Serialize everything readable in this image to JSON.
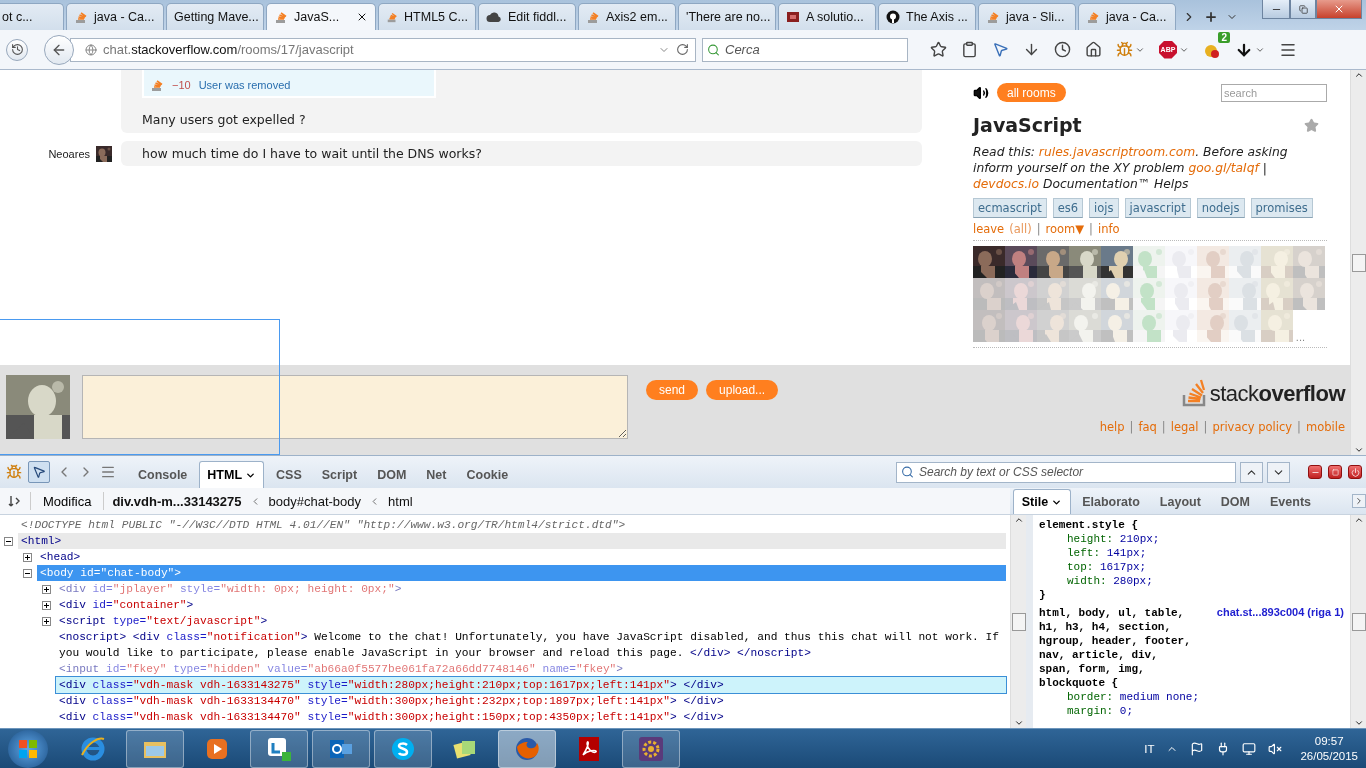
{
  "browser": {
    "tabs": [
      {
        "label": "ot c...",
        "selected": false,
        "kind": "plain"
      },
      {
        "label": "java - Ca...",
        "selected": false,
        "kind": "so"
      },
      {
        "label": "Getting Mave...",
        "selected": false,
        "kind": "plain"
      },
      {
        "label": "JavaS...",
        "selected": true,
        "kind": "so"
      },
      {
        "label": "HTML5 C...",
        "selected": false,
        "kind": "so"
      },
      {
        "label": "Edit fiddl...",
        "selected": false,
        "kind": "cloud"
      },
      {
        "label": "Axis2 em...",
        "selected": false,
        "kind": "so"
      },
      {
        "label": "'There are no...",
        "selected": false,
        "kind": "plain"
      },
      {
        "label": "A solutio...",
        "selected": false,
        "kind": "red"
      },
      {
        "label": "The Axis ...",
        "selected": false,
        "kind": "github"
      },
      {
        "label": "java - Sli...",
        "selected": false,
        "kind": "so"
      },
      {
        "label": "java - Ca...",
        "selected": false,
        "kind": "so"
      }
    ],
    "url_prefix": "chat.",
    "url_domain": "stackoverflow.com",
    "url_path": "/rooms/17/javascript",
    "search_placeholder": "Cerca",
    "adblock_label": "ABP",
    "notification_count": "2"
  },
  "chat": {
    "notice": {
      "score": "−10",
      "text": "User was removed"
    },
    "messages": [
      {
        "text": "Many users got expelled ?"
      },
      {
        "user": "Neoares",
        "text": "how much time do I have to wait until the DNS works?"
      }
    ],
    "send_label": "send",
    "upload_label": "upload..."
  },
  "sidebar": {
    "all_rooms": "all rooms",
    "search_placeholder": "search",
    "title": "JavaScript",
    "starred": false,
    "description": [
      {
        "text": "Read this: ",
        "link": false
      },
      {
        "text": "rules.javascriptroom.com",
        "link": true
      },
      {
        "text": ". Before asking inform yourself on the XY problem ",
        "link": false
      },
      {
        "text": "goo.gl/taIqf",
        "link": true
      },
      {
        "text": " | ",
        "link": false
      },
      {
        "text": "devdocs.io",
        "link": true
      },
      {
        "text": " Documentation™ Helps",
        "link": false
      }
    ],
    "tags": [
      "ecmascript",
      "es6",
      "iojs",
      "javascript",
      "nodejs",
      "promises"
    ],
    "room_links": [
      {
        "text": "leave",
        "kind": "link"
      },
      {
        "text": "(all)",
        "kind": "muted"
      },
      {
        "text": "|",
        "kind": "sep"
      },
      {
        "text": "room▼",
        "kind": "link"
      },
      {
        "text": "|",
        "kind": "sep"
      },
      {
        "text": "info",
        "kind": "link"
      }
    ],
    "members": [
      {
        "kind": "picture",
        "faded": false
      },
      {
        "kind": "picture",
        "faded": false
      },
      {
        "kind": "picture",
        "faded": false
      },
      {
        "kind": "picture",
        "faded": false
      },
      {
        "kind": "picture",
        "faded": false
      },
      {
        "kind": "picture",
        "faded": true
      },
      {
        "kind": "picture",
        "faded": true
      },
      {
        "kind": "picture",
        "faded": true
      },
      {
        "kind": "picture",
        "faded": true
      },
      {
        "kind": "picture",
        "faded": true
      },
      {
        "kind": "picture",
        "faded": true
      },
      {
        "kind": "picture",
        "faded": true
      },
      {
        "kind": "picture",
        "faded": true
      },
      {
        "kind": "picture",
        "faded": true
      },
      {
        "kind": "picture",
        "faded": true
      },
      {
        "kind": "picture",
        "faded": true
      },
      {
        "kind": "picture",
        "faded": true
      },
      {
        "kind": "picture",
        "faded": true
      },
      {
        "kind": "picture",
        "faded": true
      },
      {
        "kind": "picture",
        "faded": true
      },
      {
        "kind": "picture",
        "faded": true
      },
      {
        "kind": "picture",
        "faded": true
      },
      {
        "kind": "picture",
        "faded": true
      },
      {
        "kind": "picture",
        "faded": true
      },
      {
        "kind": "picture",
        "faded": true
      },
      {
        "kind": "picture",
        "faded": true
      },
      {
        "kind": "picture",
        "faded": true
      },
      {
        "kind": "picture",
        "faded": true
      },
      {
        "kind": "picture",
        "faded": true
      },
      {
        "kind": "picture",
        "faded": true
      },
      {
        "kind": "picture",
        "faded": true
      },
      {
        "kind": "picture",
        "faded": true
      }
    ],
    "more_members": "...",
    "logo": {
      "light": "stack",
      "bold": "overflow"
    },
    "footer_links": [
      {
        "text": "help",
        "kind": "link"
      },
      {
        "text": "|",
        "kind": "sep"
      },
      {
        "text": "faq",
        "kind": "link"
      },
      {
        "text": "|",
        "kind": "sep"
      },
      {
        "text": "legal",
        "kind": "link"
      },
      {
        "text": "|",
        "kind": "sep"
      },
      {
        "text": "privacy policy",
        "kind": "link"
      },
      {
        "text": "|",
        "kind": "sep"
      },
      {
        "text": "mobile",
        "kind": "link"
      }
    ]
  },
  "devtools": {
    "tabs": [
      {
        "label": "Console",
        "selected": false,
        "menu": false
      },
      {
        "label": "HTML",
        "selected": true,
        "menu": true
      },
      {
        "label": "CSS",
        "selected": false,
        "menu": false
      },
      {
        "label": "Script",
        "selected": false,
        "menu": false
      },
      {
        "label": "DOM",
        "selected": false,
        "menu": false
      },
      {
        "label": "Net",
        "selected": false,
        "menu": false
      },
      {
        "label": "Cookie",
        "selected": false,
        "menu": false
      }
    ],
    "search_placeholder": "Search by text or CSS selector",
    "edit_label": "Modifica",
    "breadcrumbs": [
      {
        "label": "div.vdh-m...33143275",
        "selected": true
      },
      {
        "label": "body#chat-body",
        "selected": false
      },
      {
        "label": "html",
        "selected": false
      }
    ],
    "side_tabs": [
      {
        "label": "Stile",
        "selected": true,
        "menu": true
      },
      {
        "label": "Elaborato",
        "selected": false,
        "menu": false
      },
      {
        "label": "Layout",
        "selected": false,
        "menu": false
      },
      {
        "label": "DOM",
        "selected": false,
        "menu": false
      },
      {
        "label": "Events",
        "selected": false,
        "menu": false
      }
    ],
    "html_tree": [
      {
        "selected": false,
        "hovered": false,
        "inspected": false,
        "hidden": false,
        "segments": [
          {
            "t": "<!DOCTYPE html PUBLIC \"-//W3C//DTD HTML 4.01//EN\" \"http://www.w3.org/TR/html4/strict.dtd\">",
            "kind": "doctype"
          }
        ]
      },
      {
        "selected": false,
        "hovered": true,
        "inspected": false,
        "hidden": false,
        "expanded": true,
        "segments": [
          {
            "t": "<html>",
            "kind": "tag"
          }
        ],
        "children": [
          {
            "selected": false,
            "hovered": false,
            "inspected": false,
            "hidden": false,
            "expanded": false,
            "segments": [
              {
                "t": "<head>",
                "kind": "tag"
              }
            ]
          },
          {
            "selected": true,
            "hovered": false,
            "inspected": false,
            "hidden": false,
            "expanded": true,
            "segments": [
              {
                "t": "<body ",
                "kind": "tag"
              },
              {
                "t": "id=",
                "kind": "attr"
              },
              {
                "t": "\"chat-body\"",
                "kind": "value"
              },
              {
                "t": ">",
                "kind": "tag"
              }
            ],
            "children": [
              {
                "selected": false,
                "hovered": false,
                "inspected": false,
                "hidden": true,
                "expanded": false,
                "segments": [
                  {
                    "t": "<div ",
                    "kind": "tag"
                  },
                  {
                    "t": "id=",
                    "kind": "attr"
                  },
                  {
                    "t": "\"jplayer\"",
                    "kind": "value"
                  },
                  {
                    "t": " style=",
                    "kind": "attr"
                  },
                  {
                    "t": "\"width: 0px; height: 0px;\"",
                    "kind": "value"
                  },
                  {
                    "t": ">",
                    "kind": "tag"
                  }
                ]
              },
              {
                "selected": false,
                "hovered": false,
                "inspected": false,
                "hidden": false,
                "expanded": false,
                "segments": [
                  {
                    "t": "<div ",
                    "kind": "tag"
                  },
                  {
                    "t": "id=",
                    "kind": "attr"
                  },
                  {
                    "t": "\"container\"",
                    "kind": "value"
                  },
                  {
                    "t": ">",
                    "kind": "tag"
                  }
                ]
              },
              {
                "selected": false,
                "hovered": false,
                "inspected": false,
                "hidden": false,
                "expanded": false,
                "segments": [
                  {
                    "t": "<script ",
                    "kind": "tag"
                  },
                  {
                    "t": "type=",
                    "kind": "attr"
                  },
                  {
                    "t": "\"text/javascript\"",
                    "kind": "value"
                  },
                  {
                    "t": ">",
                    "kind": "tag"
                  }
                ]
              },
              {
                "selected": false,
                "hovered": false,
                "inspected": false,
                "hidden": false,
                "segments": [
                  {
                    "t": "<noscript> ",
                    "kind": "tag"
                  },
                  {
                    "t": "<div ",
                    "kind": "tag"
                  },
                  {
                    "t": "class=",
                    "kind": "attr"
                  },
                  {
                    "t": "\"notification\"",
                    "kind": "value"
                  },
                  {
                    "t": ">",
                    "kind": "tag"
                  },
                  {
                    "t": " Welcome to the chat! Unfortunately, you have JavaScript disabled, and thus this chat will not work. If you would like to participate, please enable JavaScript in your browser and reload this page. ",
                    "kind": "text"
                  },
                  {
                    "t": "</div>",
                    "kind": "tag"
                  },
                  {
                    "t": " </noscript>",
                    "kind": "tag"
                  }
                ]
              },
              {
                "selected": false,
                "hovered": false,
                "inspected": false,
                "hidden": true,
                "segments": [
                  {
                    "t": "<input ",
                    "kind": "tag"
                  },
                  {
                    "t": "id=",
                    "kind": "attr"
                  },
                  {
                    "t": "\"fkey\"",
                    "kind": "value"
                  },
                  {
                    "t": " type=",
                    "kind": "attr"
                  },
                  {
                    "t": "\"hidden\"",
                    "kind": "value"
                  },
                  {
                    "t": " value=",
                    "kind": "attr"
                  },
                  {
                    "t": "\"ab66a0f5577be061fa72a66dd7748146\"",
                    "kind": "value"
                  },
                  {
                    "t": " name=",
                    "kind": "attr"
                  },
                  {
                    "t": "\"fkey\"",
                    "kind": "value"
                  },
                  {
                    "t": ">",
                    "kind": "tag"
                  }
                ]
              },
              {
                "selected": false,
                "hovered": false,
                "inspected": true,
                "hidden": false,
                "segments": [
                  {
                    "t": "<div ",
                    "kind": "tag"
                  },
                  {
                    "t": "class=",
                    "kind": "attr"
                  },
                  {
                    "t": "\"vdh-mask vdh-1633143275\"",
                    "kind": "value"
                  },
                  {
                    "t": " style=",
                    "kind": "attr"
                  },
                  {
                    "t": "\"width:280px;height:210px;top:1617px;left:141px\"",
                    "kind": "value"
                  },
                  {
                    "t": "> </div>",
                    "kind": "tag"
                  }
                ]
              },
              {
                "selected": false,
                "hovered": false,
                "inspected": false,
                "hidden": false,
                "segments": [
                  {
                    "t": "<div ",
                    "kind": "tag"
                  },
                  {
                    "t": "class=",
                    "kind": "attr"
                  },
                  {
                    "t": "\"vdh-mask vdh-1633134470\"",
                    "kind": "value"
                  },
                  {
                    "t": " style=",
                    "kind": "attr"
                  },
                  {
                    "t": "\"width:300px;height:232px;top:1897px;left:141px\"",
                    "kind": "value"
                  },
                  {
                    "t": "> </div>",
                    "kind": "tag"
                  }
                ]
              },
              {
                "selected": false,
                "hovered": false,
                "inspected": false,
                "hidden": false,
                "segments": [
                  {
                    "t": "<div ",
                    "kind": "tag"
                  },
                  {
                    "t": "class=",
                    "kind": "attr"
                  },
                  {
                    "t": "\"vdh-mask vdh-1633134470\"",
                    "kind": "value"
                  },
                  {
                    "t": " style=",
                    "kind": "attr"
                  },
                  {
                    "t": "\"width:300px;height:150px;top:4350px;left:141px\"",
                    "kind": "value"
                  },
                  {
                    "t": "> </div>",
                    "kind": "tag"
                  }
                ]
              }
            ]
          }
        ]
      }
    ],
    "css_rules": [
      {
        "selector_lines": [
          "element.style {"
        ],
        "props": [
          {
            "name": "height:",
            "value": "210px;"
          },
          {
            "name": "left:",
            "value": "141px;"
          },
          {
            "name": "top:",
            "value": "1617px;"
          },
          {
            "name": "width:",
            "value": "280px;"
          }
        ],
        "close": "}"
      },
      {
        "selector_lines": [
          "html, body, ul, table,",
          "h1, h3, h4, section,",
          "hgroup, header, footer,",
          "nav, article, div,",
          "span, form, img,",
          "blockquote {"
        ],
        "source": "chat.st...893c004 (riga 1)",
        "props": [
          {
            "name": "border:",
            "value": "medium none;"
          },
          {
            "name": "margin:",
            "value": "0;"
          }
        ]
      }
    ]
  },
  "taskbar": {
    "apps": [
      {
        "kind": "ie",
        "running": false,
        "selected": false
      },
      {
        "kind": "folder",
        "running": true,
        "selected": false
      },
      {
        "kind": "media",
        "running": false,
        "selected": false
      },
      {
        "kind": "lync",
        "running": true,
        "selected": false
      },
      {
        "kind": "outlook",
        "running": true,
        "selected": false
      },
      {
        "kind": "skype",
        "running": true,
        "selected": false
      },
      {
        "kind": "notes",
        "running": false,
        "selected": false
      },
      {
        "kind": "firefox",
        "running": true,
        "selected": true
      },
      {
        "kind": "acrobat",
        "running": false,
        "selected": false
      },
      {
        "kind": "ide",
        "running": true,
        "selected": false
      }
    ],
    "language": "IT",
    "time": "09:57",
    "date": "26/05/2015"
  }
}
